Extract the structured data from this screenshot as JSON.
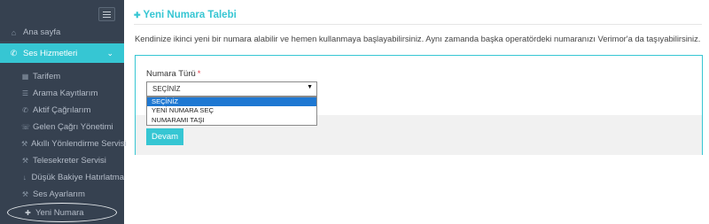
{
  "sidebar": {
    "home_label": "Ana sayfa",
    "ses_label": "Ses Hizmetleri",
    "items": [
      {
        "label": "Tarifem",
        "icon": "table-icon"
      },
      {
        "label": "Arama Kayıtlarım",
        "icon": "list-icon"
      },
      {
        "label": "Aktif Çağrılarım",
        "icon": "phone-icon"
      },
      {
        "label": "Gelen Çağrı Yönetimi",
        "icon": "call-icon"
      },
      {
        "label": "Akıllı Yönlendirme Servisi",
        "icon": "wrench-icon"
      },
      {
        "label": "Telesekreter Servisi",
        "icon": "voicemail-icon"
      },
      {
        "label": "Düşük Bakiye Hatırlatma",
        "icon": "arrow-down-icon"
      },
      {
        "label": "Ses Ayarlarım",
        "icon": "wrench-icon"
      },
      {
        "label": "Yeni Numara",
        "icon": "plus-circle-icon"
      }
    ]
  },
  "main": {
    "title": "Yeni Numara Talebi",
    "intro": "Kendinize ikinci yeni bir numara alabilir ve hemen kullanmaya başlayabilirsiniz. Aynı zamanda başka operatördeki numaranızı Verimor'a da taşıyabilirsiniz.",
    "form": {
      "label": "Numara Türü",
      "required_mark": "*",
      "selected": "SEÇİNİZ",
      "options": [
        "SEÇİNİZ",
        "YENİ NUMARA SEÇ",
        "NUMARAMI TAŞI"
      ]
    },
    "submit_label": "Devam"
  },
  "colors": {
    "accent": "#36c6d3",
    "sidebar": "#364150",
    "selected_option": "#1e78d2"
  }
}
